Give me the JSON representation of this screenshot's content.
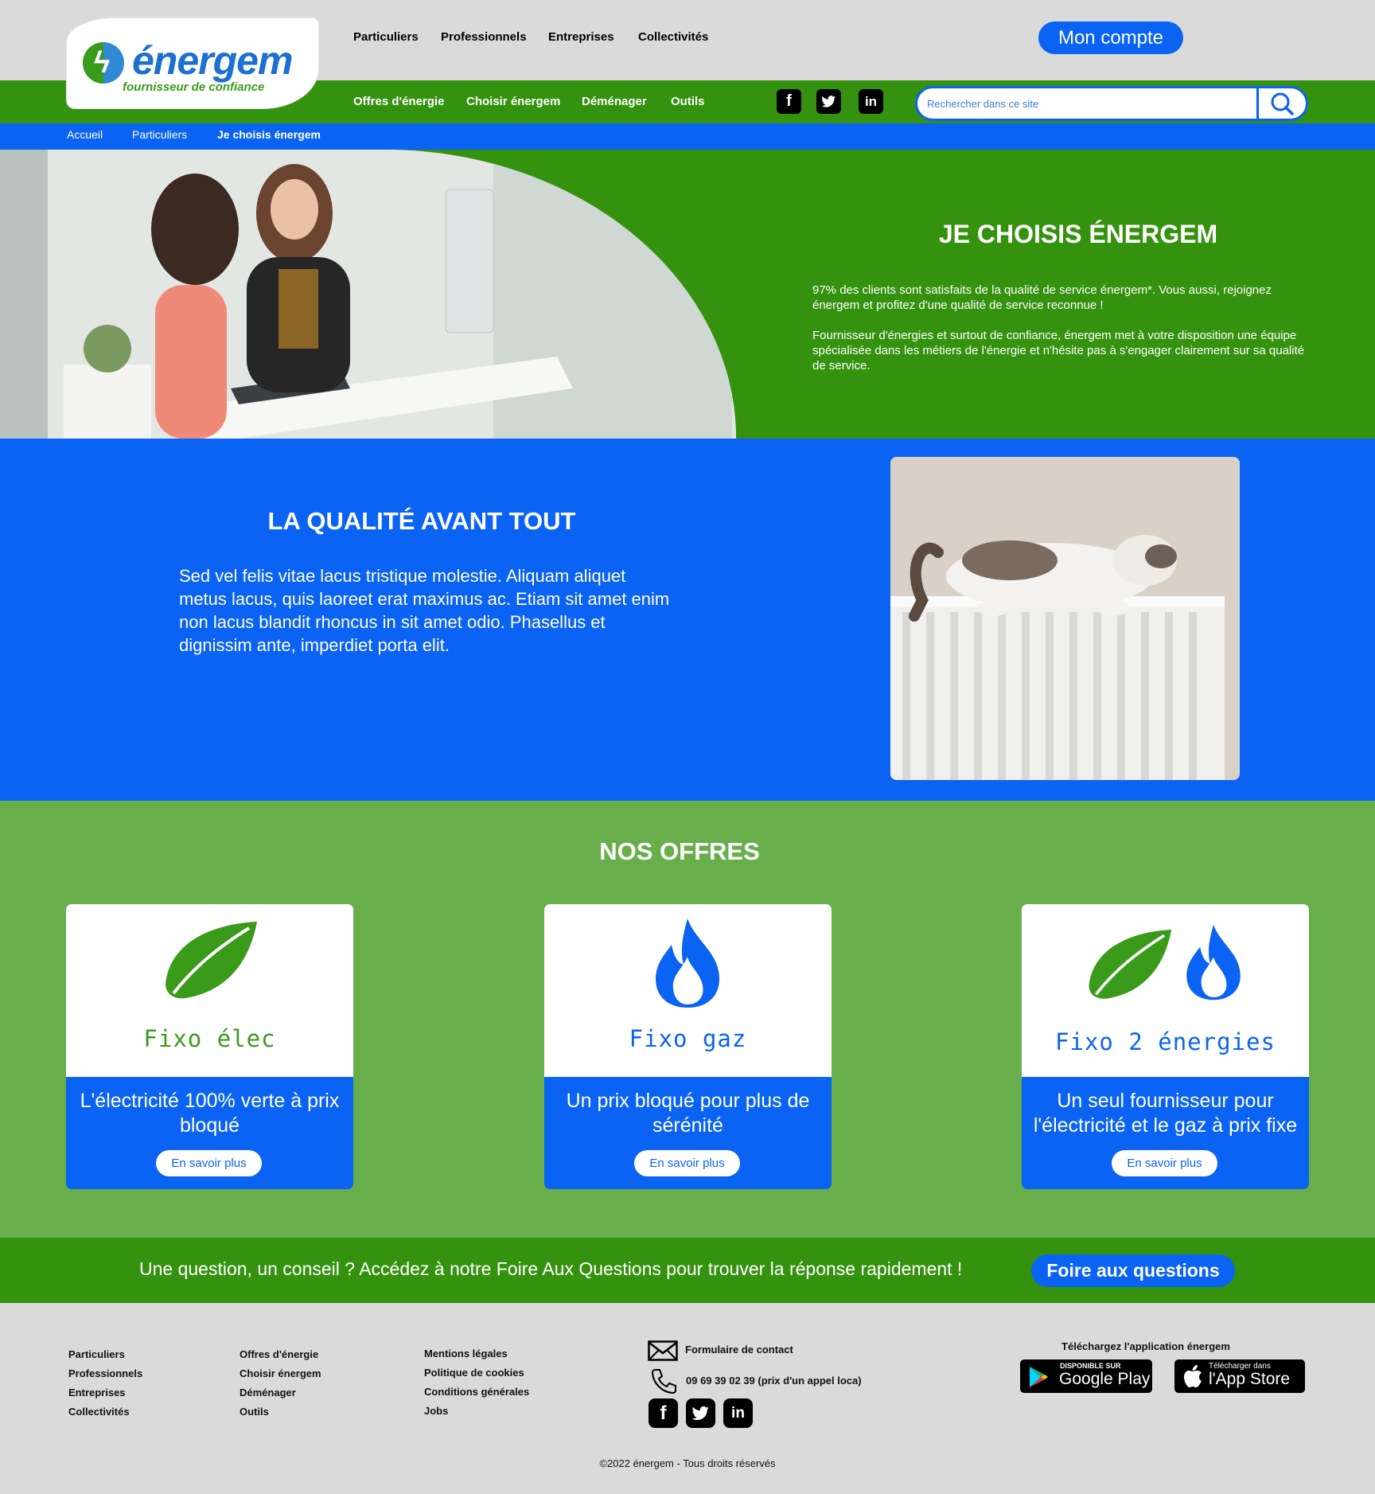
{
  "header": {
    "logo_name": "énergem",
    "logo_sub": "fournisseur de confiance",
    "top_nav": [
      "Particuliers",
      "Professionnels",
      "Entreprises",
      "Collectivités"
    ],
    "account_button": "Mon compte",
    "sub_nav": [
      "Offres d'énergie",
      "Choisir énergem",
      "Déménager",
      "Outils"
    ],
    "search_placeholder": "Rechercher dans ce site"
  },
  "breadcrumb": [
    "Accueil",
    "Particuliers",
    "Je choisis énergem"
  ],
  "hero": {
    "title": "JE CHOISIS ÉNERGEM",
    "paragraphs": [
      "97% des clients sont satisfaits de la qualité de service énergem*. Vous aussi, rejoignez énergem et profitez d'une qualité de service reconnue !",
      "Fournisseur d'énergies et surtout de confiance, énergem met à votre disposition une équipe spécialisée dans les métiers de l'énergie et n'hésite pas à s'engager clairement sur sa qualité de service."
    ]
  },
  "quality": {
    "title": "LA QUALITÉ AVANT TOUT",
    "text": "Sed vel felis vitae lacus tristique molestie. Aliquam aliquet metus lacus, quis laoreet erat maximus ac. Etiam sit amet enim non lacus blandit rhoncus in sit amet odio. Phasellus et dignissim ante, imperdiet porta elit."
  },
  "offers": {
    "title": "NOS OFFRES",
    "cards": [
      {
        "name": "Fixo élec",
        "desc": "L'électricité 100% verte à prix bloqué",
        "button": "En savoir plus",
        "icon": "leaf-icon",
        "color": "#3a9a1a"
      },
      {
        "name": "Fixo gaz",
        "desc": "Un prix bloqué pour plus de sérénité",
        "button": "En savoir plus",
        "icon": "flame-icon",
        "color": "#0a63f2"
      },
      {
        "name": "Fixo 2 énergies",
        "desc": "Un seul fournisseur pour l'électricité et le gaz à prix fixe",
        "button": "En savoir plus",
        "icon": "leaf-flame-icon",
        "color": "#0a63f2"
      }
    ]
  },
  "faq": {
    "text": "Une question, un conseil ? Accédez à notre Foire Aux Questions pour trouver la réponse rapidement !",
    "button": "Foire aux questions"
  },
  "footer": {
    "col1": [
      "Particuliers",
      "Professionnels",
      "Entreprises",
      "Collectivités"
    ],
    "col2": [
      "Offres d'énergie",
      "Choisir énergem",
      "Déménager",
      "Outils"
    ],
    "col3": [
      "Mentions légales",
      "Politique de cookies",
      "Conditions générales",
      "Jobs"
    ],
    "contact_form": "Formulaire de contact",
    "phone": "09 69 39 02 39 (prix d'un appel loca)",
    "app_title": "Téléchargez l'application énergem",
    "google_small": "DISPONIBLE SUR",
    "google_big": "Google Play",
    "apple_small": "Télécharger dans",
    "apple_big": "l'App Store",
    "copyright": "©2022 énergem - Tous droits réservés"
  },
  "colors": {
    "green": "#35920f",
    "light_green": "#68ae4b",
    "blue": "#0a63f2",
    "grey": "#dadada"
  }
}
